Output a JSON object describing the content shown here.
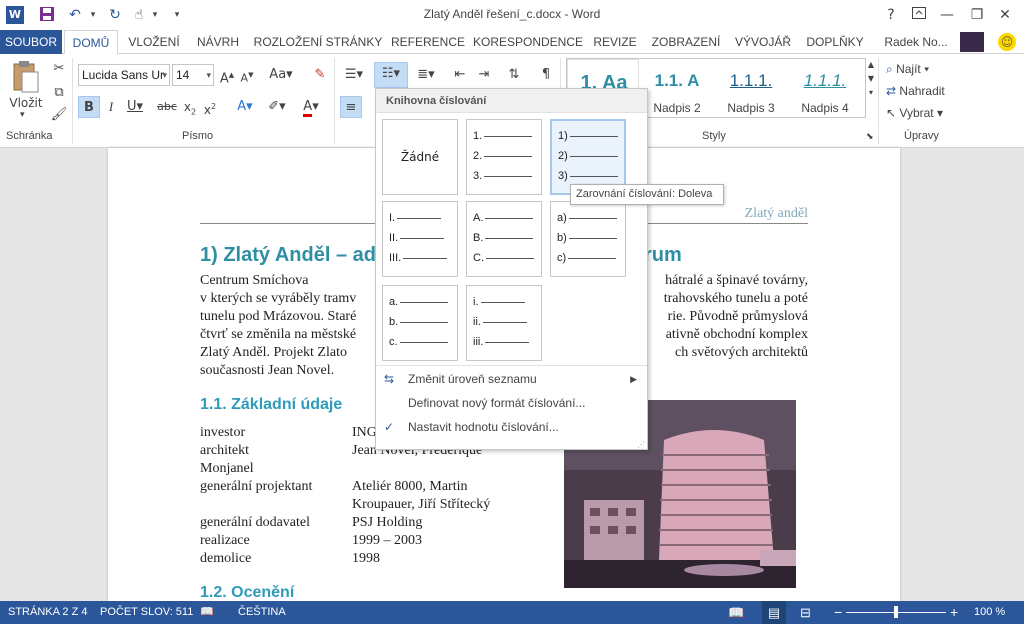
{
  "title_bar": {
    "app_icon": "word-icon",
    "title": "Zlatý Anděl řešení_c.docx - Word",
    "help": "?",
    "quick_access": [
      "save-icon",
      "undo-icon",
      "redo-icon",
      "touch-mode-icon",
      "customize-icon"
    ]
  },
  "tabs": [
    "SOUBOR",
    "DOMŮ",
    "VLOŽENÍ",
    "NÁVRH",
    "ROZLOŽENÍ STRÁNKY",
    "REFERENCE",
    "KORESPONDENCE",
    "REVIZE",
    "ZOBRAZENÍ",
    "VÝVOJÁŘ",
    "DOPLŇKY"
  ],
  "active_tab": "DOMŮ",
  "user": {
    "name": "Radek No..."
  },
  "ribbon": {
    "clipboard": {
      "label": "Schránka",
      "paste": "Vložit"
    },
    "font": {
      "label": "Písmo",
      "font_name": "Lucida Sans Ur",
      "font_size": "14"
    },
    "styles": {
      "label": "Styly",
      "items": [
        {
          "sample": "1.  Aa",
          "name": ""
        },
        {
          "sample": "1.1.  A",
          "name": "Nadpis 2"
        },
        {
          "sample": "1.1.1.",
          "name": "Nadpis 3"
        },
        {
          "sample": "1.1.1.",
          "name": "Nadpis 4"
        }
      ]
    },
    "editing": {
      "label": "Úpravy",
      "find": "Najít",
      "replace": "Nahradit",
      "select": "Vybrat"
    }
  },
  "document": {
    "header_text": "Zlatý anděl",
    "heading1": "1)  Zlatý Anděl – ad",
    "heading1_tail": "rum",
    "para_left": [
      "             Centrum Smíchova",
      "v kterých se vyráběly tramv",
      "tunelu pod Mrázovou. Staré",
      "čtvrť se změnila na městské",
      "Zlatý Anděl. Projekt Zlato",
      "současnosti Jean Novel."
    ],
    "para_right": [
      "hátralé a špinavé továrny,",
      "trahovského tunelu a poté",
      "rie. Původně průmyslová",
      "ativně obchodní komplex",
      "ch světových architektů"
    ],
    "heading2a": "1.1. Základní údaje",
    "table": [
      {
        "key": "investor",
        "val": "ING"
      },
      {
        "key": "architekt",
        "val": "Jean Novel, Frederique"
      },
      {
        "key": "Monjanel",
        "val": ""
      },
      {
        "key": "generální projektant",
        "val": "Ateliér 8000, Martin"
      },
      {
        "key": "",
        "val": "Kroupauer, Jiří Střítecký"
      },
      {
        "key": "generální dodavatel",
        "val": "PSJ Holding"
      },
      {
        "key": "realizace",
        "val": "1999 – 2003"
      },
      {
        "key": "demolice",
        "val": "1998"
      }
    ],
    "heading2b": "1.2. Ocenění"
  },
  "numbering_dropdown": {
    "title": "Knihovna číslování",
    "none_label": "Žádné",
    "tiles": [
      {
        "markers": [
          "1.",
          "2.",
          "3."
        ]
      },
      {
        "markers": [
          "1)",
          "2)",
          "3)"
        ]
      },
      {
        "markers": [
          "I.",
          "II.",
          "III."
        ]
      },
      {
        "markers": [
          "A.",
          "B.",
          "C."
        ]
      },
      {
        "markers": [
          "a)",
          "b)",
          "c)"
        ]
      },
      {
        "markers": [
          "a.",
          "b.",
          "c."
        ]
      },
      {
        "markers": [
          "i.",
          "ii.",
          "iii."
        ]
      }
    ],
    "menu": [
      {
        "label": "Změnit úroveň seznamu",
        "icon": "indent-level-icon",
        "submenu": true
      },
      {
        "label": "Definovat nový formát číslování...",
        "icon": "",
        "submenu": false
      },
      {
        "label": "Nastavit hodnotu číslování...",
        "icon": "set-number-icon",
        "submenu": false
      }
    ]
  },
  "tooltip": "Zarovnání číslování: Doleva",
  "status": {
    "page": "STRÁNKA 2 Z 4",
    "words": "POČET SLOV: 511",
    "language": "ČEŠTINA",
    "zoom": "100 %",
    "zoom_level": 100
  }
}
